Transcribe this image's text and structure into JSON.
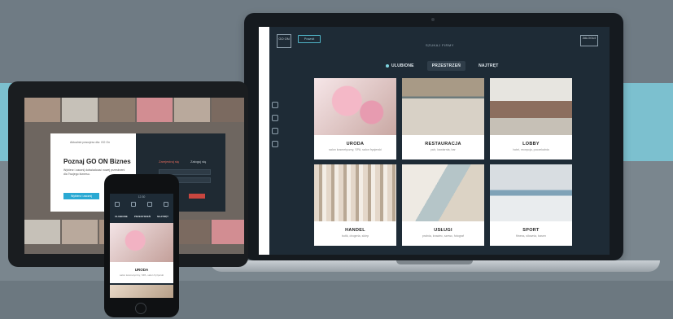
{
  "laptop": {
    "logo": "GO ON",
    "back_label": "Powrót",
    "search_label": "SZUKAJ FIRMY",
    "lang_label": "ZALOGUJ",
    "tabs": [
      {
        "label": "ULUBIONE"
      },
      {
        "label": "PRZESTRZEŃ"
      },
      {
        "label": "NAJTRĘT"
      }
    ],
    "cards": [
      {
        "title": "URODA",
        "subtitle": "salon kosmetyczny, SPA, salon fryzjerski"
      },
      {
        "title": "RESTAURACJA",
        "subtitle": "pub, kawiarnia, bar"
      },
      {
        "title": "LOBBY",
        "subtitle": "hotel, recepcja, poczekalnia"
      },
      {
        "title": "HANDEL",
        "subtitle": "butik, drogeria, sklep"
      },
      {
        "title": "USŁUGI",
        "subtitle": "pralnia, krawiec, szewc, fotograf"
      },
      {
        "title": "SPORT",
        "subtitle": "fitness, siłownia, basen"
      }
    ]
  },
  "tablet": {
    "small_text": "Aktualnie pracujesz dla: GO On",
    "title": "Poznaj GO ON Biznes",
    "text": "Wybierz i zacznij doświadczać nowej przestrzeni dla Twojego biznesu.",
    "button": "Wybierz i zacznij",
    "login_tab_active": "Zarejestruj się",
    "login_tab_inactive": "Zaloguj się"
  },
  "phone": {
    "time": "12:30",
    "tabs": [
      "ULUBIONE",
      "PRZESTRZEŃ",
      "NAJTRĘT"
    ],
    "card_title": "URODA",
    "card_subtitle": "salon kosmetyczny, SPA, salon fryzjerski"
  },
  "colors": {
    "accent": "#7ed4df",
    "app_bg": "#1e2b36",
    "band": "#7cc0cf"
  }
}
